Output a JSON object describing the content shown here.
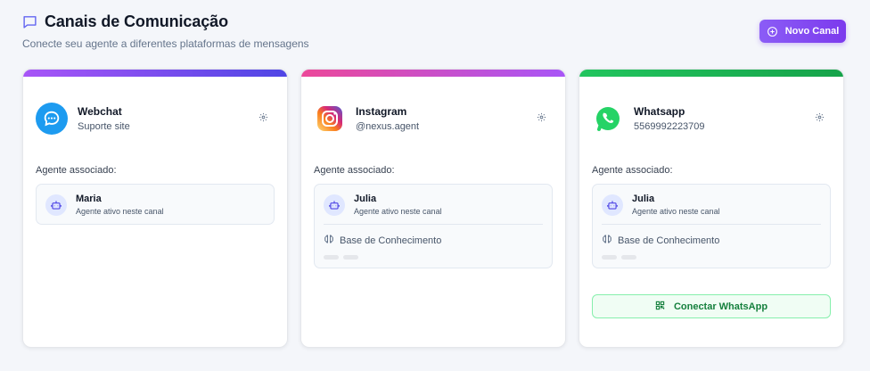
{
  "header": {
    "title": "Canais de Comunicação",
    "subtitle": "Conecte seu agente a diferentes plataformas de mensagens",
    "new_button": "Novo Canal"
  },
  "cards": [
    {
      "name": "Webchat",
      "subtitle": "Suporte site",
      "icon": "webchat-icon",
      "bar_colors": [
        "#a855f7",
        "#4f46e5"
      ],
      "assoc_label": "Agente associado:",
      "agent": {
        "name": "Maria",
        "status": "Agente ativo neste canal"
      }
    },
    {
      "name": "Instagram",
      "subtitle": "@nexus.agent",
      "icon": "instagram-icon",
      "bar_colors": [
        "#ec4899",
        "#a855f7"
      ],
      "assoc_label": "Agente associado:",
      "agent": {
        "name": "Julia",
        "status": "Agente ativo neste canal"
      },
      "knowledge": "Base de Conhecimento"
    },
    {
      "name": "Whatsapp",
      "subtitle": "5569992223709",
      "icon": "whatsapp-icon",
      "bar_colors": [
        "#22c55e",
        "#16a34a"
      ],
      "assoc_label": "Agente associado:",
      "agent": {
        "name": "Julia",
        "status": "Agente ativo neste canal"
      },
      "knowledge": "Base de Conhecimento",
      "connect_button": "Conectar WhatsApp"
    }
  ]
}
